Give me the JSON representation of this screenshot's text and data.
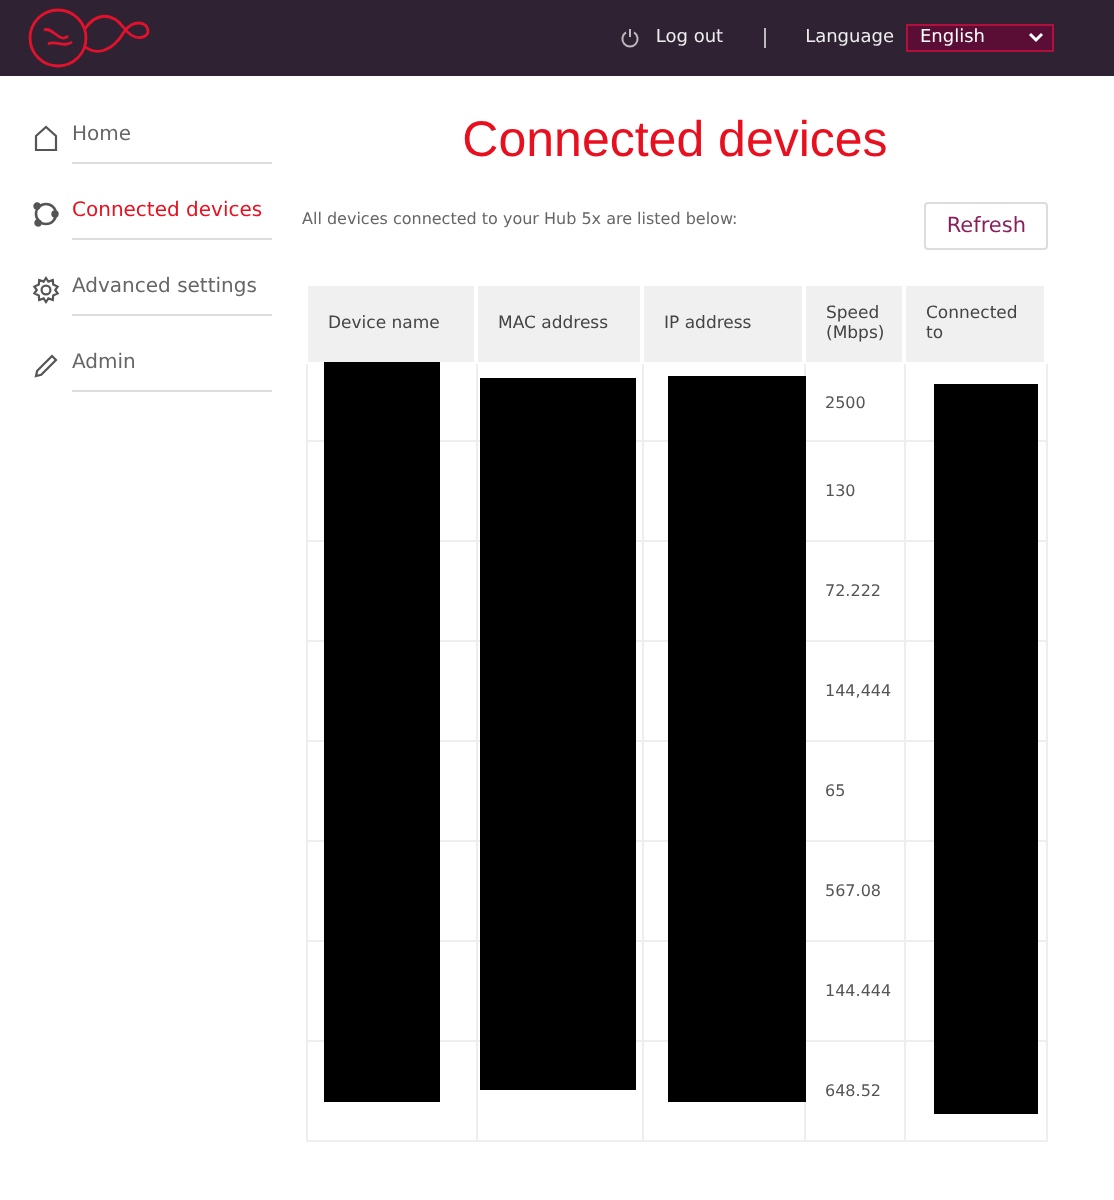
{
  "header": {
    "logout": "Log out",
    "language_label": "Language",
    "language_value": "English"
  },
  "sidebar": {
    "items": [
      {
        "label": "Home",
        "kind": "home",
        "selected": false
      },
      {
        "label": "Connected devices",
        "kind": "devices",
        "selected": true
      },
      {
        "label": "Advanced settings",
        "kind": "gear",
        "selected": false
      },
      {
        "label": "Admin",
        "kind": "pencil",
        "selected": false
      }
    ]
  },
  "page": {
    "title": "Connected devices",
    "intro": "All devices connected to your Hub 5x are listed below:",
    "refresh": "Refresh"
  },
  "table": {
    "columns": [
      "Device name",
      "MAC address",
      "IP address",
      "Speed (Mbps)",
      "Connected to"
    ],
    "rows": [
      {
        "speed": "2500"
      },
      {
        "speed": "130"
      },
      {
        "speed": "72.222"
      },
      {
        "speed": "144,444"
      },
      {
        "speed": "65"
      },
      {
        "speed": "567.08"
      },
      {
        "speed": "144.444"
      },
      {
        "speed": "648.52"
      }
    ]
  }
}
